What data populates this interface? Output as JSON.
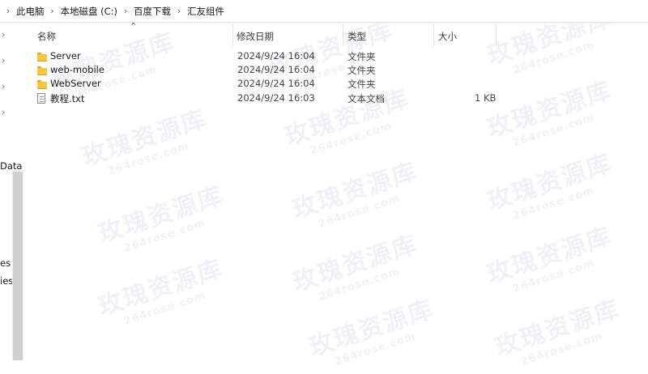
{
  "breadcrumb": {
    "items": [
      "此电脑",
      "本地磁盘 (C:)",
      "百度下载",
      "汇友组件"
    ]
  },
  "nav": {
    "labels": [
      "Data",
      "es",
      "ies"
    ]
  },
  "columns": {
    "name": "名称",
    "modified": "修改日期",
    "type": "类型",
    "size": "大小"
  },
  "files": [
    {
      "name": "Server",
      "modified": "2024/9/24 16:04",
      "type": "文件夹",
      "size": "",
      "icon": "folder-icon"
    },
    {
      "name": "web-mobile",
      "modified": "2024/9/24 16:04",
      "type": "文件夹",
      "size": "",
      "icon": "folder-icon"
    },
    {
      "name": "WebServer",
      "modified": "2024/9/24 16:04",
      "type": "文件夹",
      "size": "",
      "icon": "folder-icon"
    },
    {
      "name": "教程.txt",
      "modified": "2024/9/24 16:03",
      "type": "文本文档",
      "size": "1 KB",
      "icon": "text-file-icon"
    }
  ],
  "watermark": {
    "text": "玫瑰资源库",
    "url": "264rose.com"
  }
}
